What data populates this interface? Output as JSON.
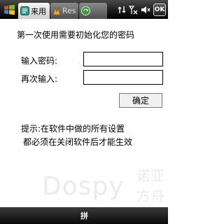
{
  "titlebar": {
    "tabs": [
      {
        "label": "来用",
        "state": "active",
        "icon": "app-icon"
      },
      {
        "label": "Res",
        "state": "inactive",
        "icon": "resco-icon"
      },
      {
        "label": "",
        "state": "inactive",
        "icon": "sync-icon"
      }
    ],
    "status_icons": [
      "sync-arrows-icon",
      "no-signal-icon",
      "speaker-mute-icon"
    ],
    "ok_label": "OK"
  },
  "form": {
    "heading": "第一次使用需要初始化您的密码",
    "password_label": "输入密码:",
    "password_value": "",
    "confirm_label": "再次输入:",
    "confirm_value": "",
    "ok_button_label": "确定",
    "hint_line1": "提示:在软件中做的所有设置",
    "hint_line2": "都必须在关闭软件后才能生效"
  },
  "watermark": {
    "text": "Dospy",
    "cn_line1": "诺亚",
    "cn_line2": "方舟"
  },
  "softbar": {
    "ime_label": "拼"
  },
  "colors": {
    "bar_dark": "#000000",
    "background": "#ffffff",
    "watermark": "#ebebeb"
  }
}
